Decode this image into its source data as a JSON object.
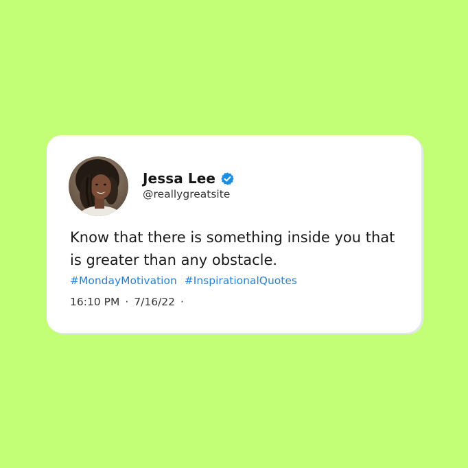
{
  "colors": {
    "background": "#c3ff76",
    "card": "#ffffff",
    "hashtag": "#2a7fd3",
    "verified_badge": "#1d8fe1"
  },
  "tweet": {
    "author": {
      "name": "Jessa Lee",
      "handle": "@reallygreatsite",
      "verified": true,
      "avatar_icon": "user-avatar-photo",
      "badge_icon": "verified-check-icon"
    },
    "text": "Know that there is something inside you that is greater than any obstacle.",
    "hashtags": [
      "#MondayMotivation",
      "#InspirationalQuotes"
    ],
    "time": "16:10 PM",
    "separator": "·",
    "date": "7/16/22",
    "trailing_separator": "·"
  }
}
